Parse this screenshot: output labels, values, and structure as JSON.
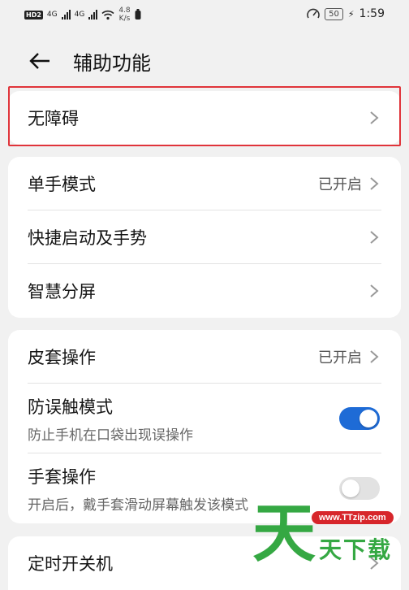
{
  "status_bar": {
    "hd_label": "HD",
    "hd_sub": "2",
    "net1": "4G",
    "net2": "4G",
    "speed_value": "4.8",
    "speed_unit": "K/s",
    "battery": "50",
    "time": "1:59"
  },
  "header": {
    "title": "辅助功能"
  },
  "section1": {
    "items": [
      {
        "label": "无障碍",
        "value": ""
      }
    ]
  },
  "section2": {
    "items": [
      {
        "label": "单手模式",
        "value": "已开启"
      },
      {
        "label": "快捷启动及手势",
        "value": ""
      },
      {
        "label": "智慧分屏",
        "value": ""
      }
    ]
  },
  "section3": {
    "items": [
      {
        "label": "皮套操作",
        "value": "已开启"
      },
      {
        "label": "防误触模式",
        "sub": "防止手机在口袋出现误操作",
        "toggle": "on"
      },
      {
        "label": "手套操作",
        "sub": "开启后，戴手套滑动屏幕触发该模式",
        "toggle": "off"
      }
    ]
  },
  "section4": {
    "items": [
      {
        "label": "定时开关机"
      }
    ]
  },
  "watermark": {
    "url": "www.TTzip.com",
    "big": "天",
    "text": "天下载"
  },
  "colors": {
    "toggle_on": "#1e6bd6",
    "highlight": "#e0343a",
    "watermark_green": "#35a843"
  }
}
